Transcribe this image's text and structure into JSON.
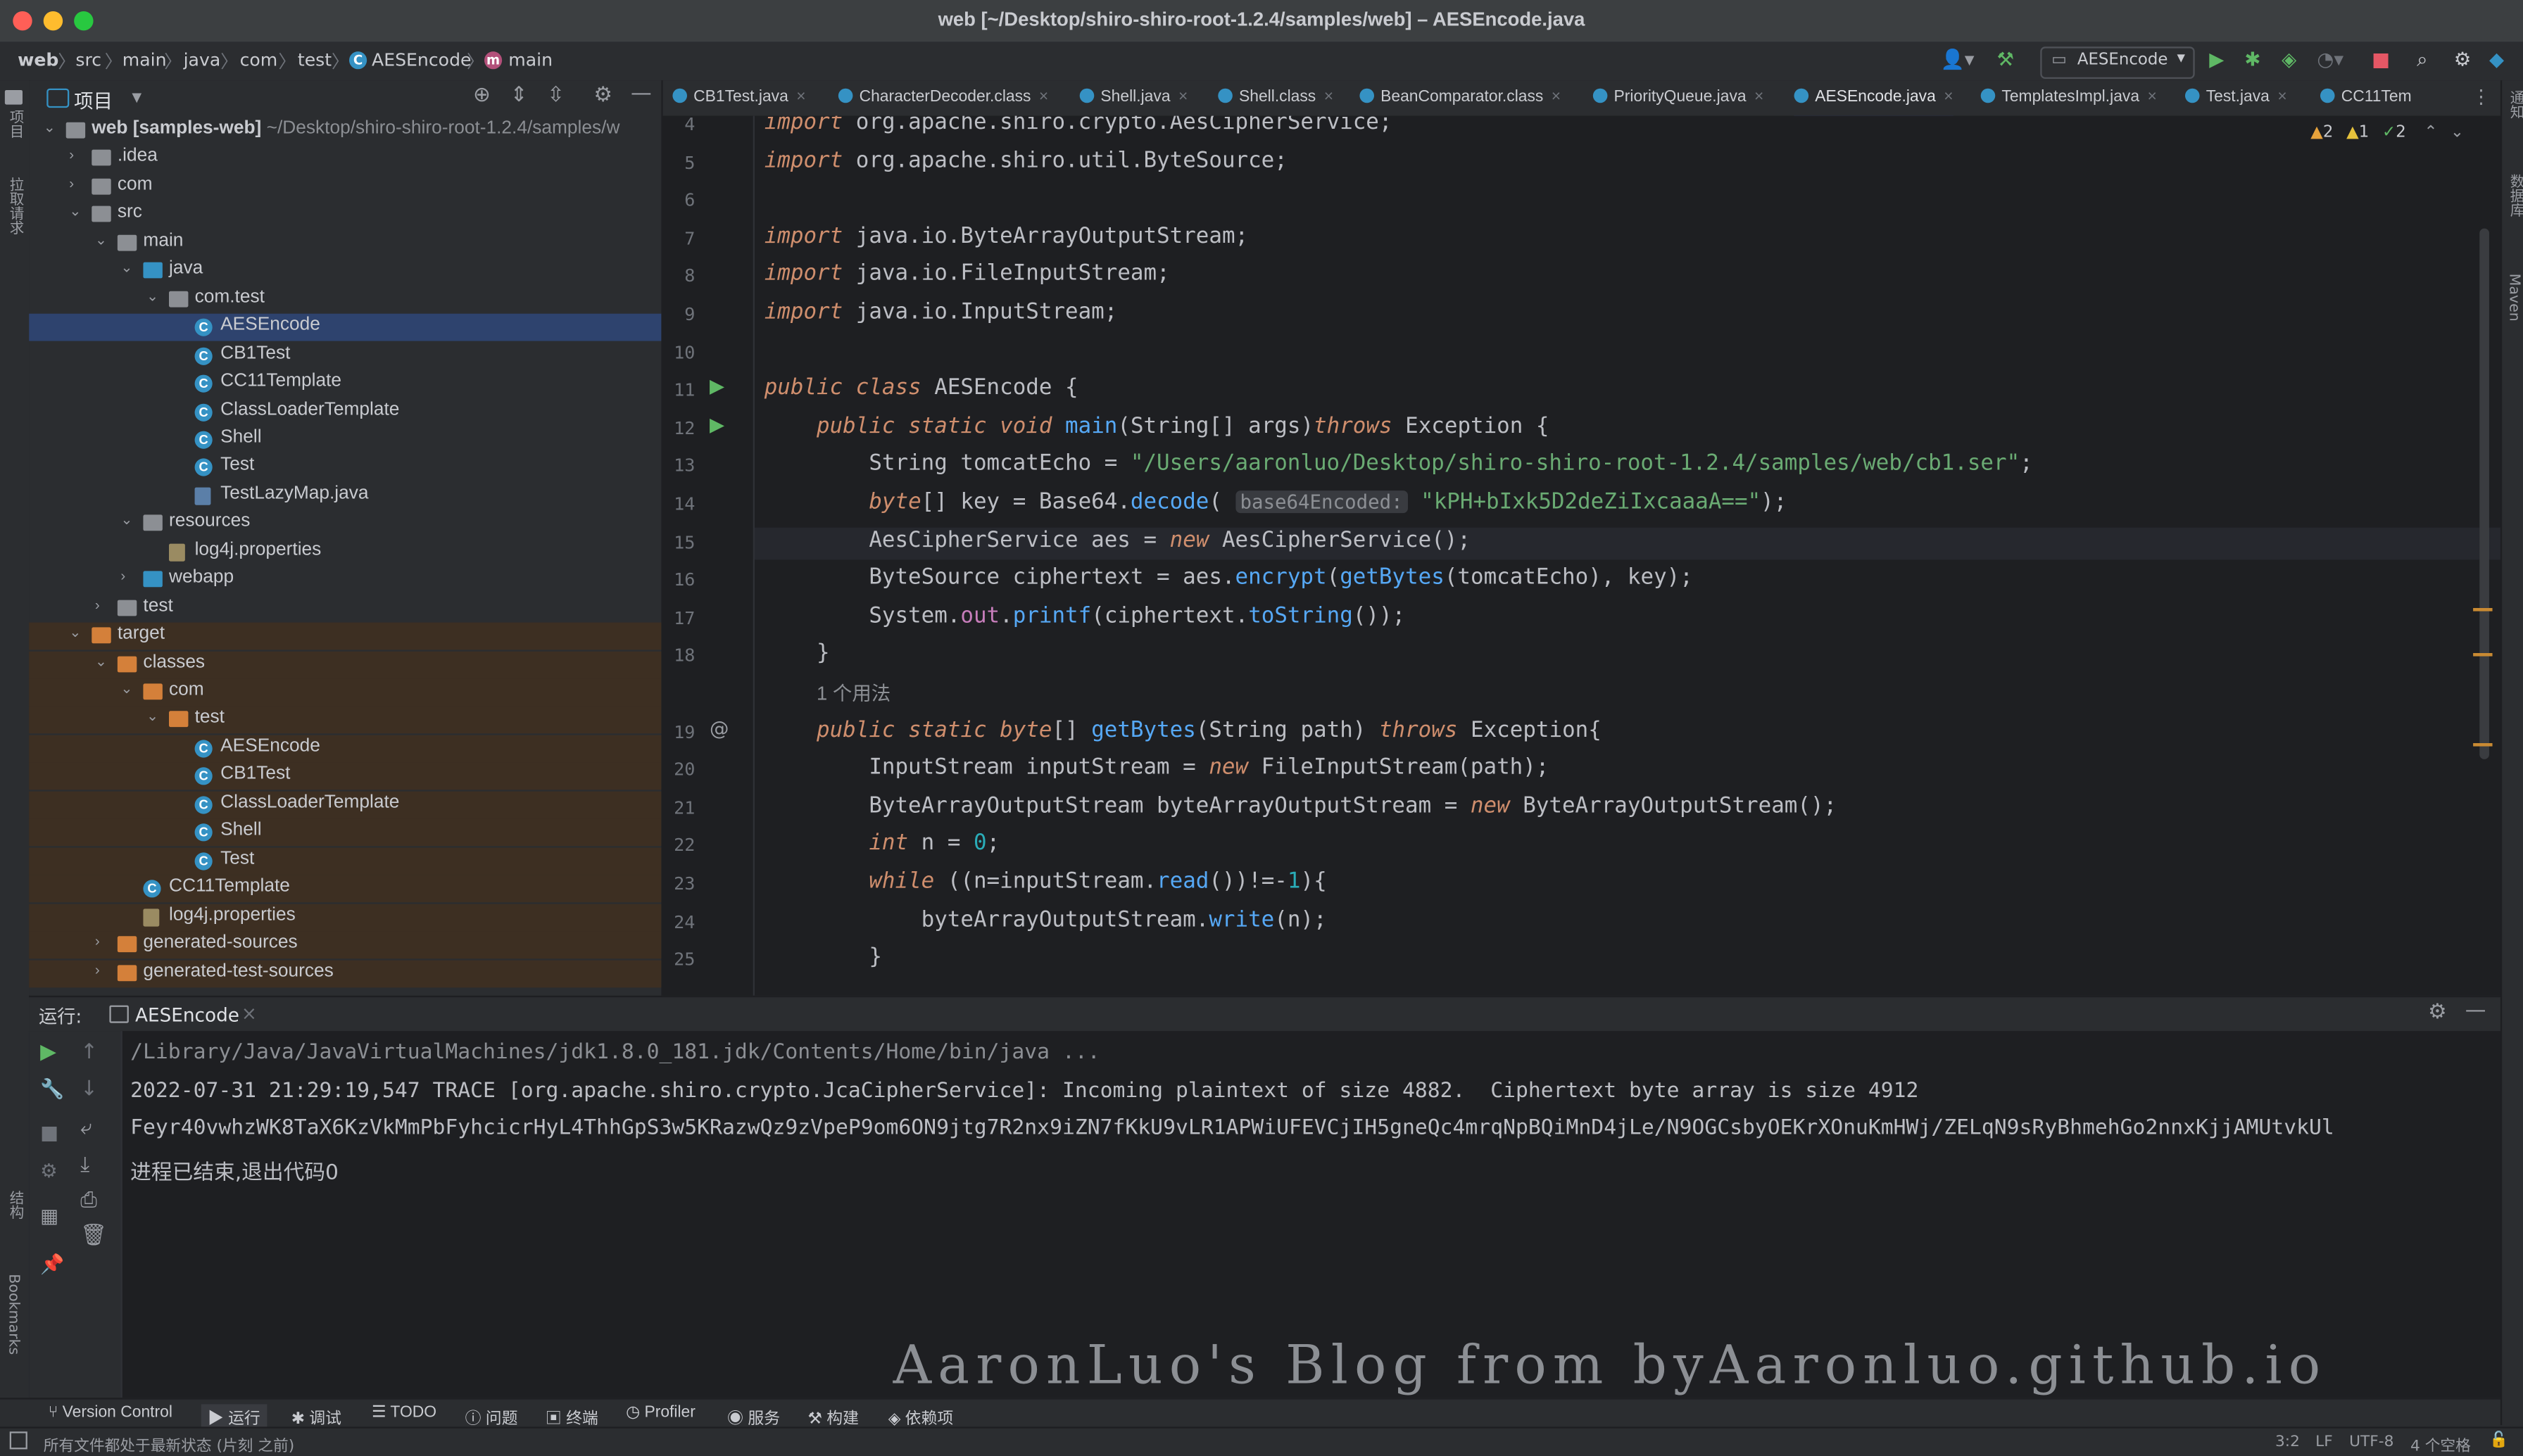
{
  "window": {
    "title": "web [~/Desktop/shiro-shiro-root-1.2.4/samples/web] – AESEncode.java"
  },
  "navbar": {
    "crumbs": [
      "web",
      "src",
      "main",
      "java",
      "com",
      "test",
      "AESEncode",
      "main"
    ],
    "run_config": "AESEncode"
  },
  "left_stripe": {
    "top": "项目",
    "mid": "拉取请求",
    "structure": "结构",
    "bookmarks": "Bookmarks"
  },
  "right_stripe": {
    "top": "通知",
    "db": "数据库",
    "maven": "Maven"
  },
  "project": {
    "header": "项目",
    "tree": [
      {
        "label": "web [samples-web]",
        "suffix": " ~/Desktop/shiro-shiro-root-1.2.4/samples/w",
        "type": "module",
        "depth": 0,
        "open": true
      },
      {
        "label": ".idea",
        "type": "folder",
        "depth": 1,
        "open": false
      },
      {
        "label": "com",
        "type": "folder",
        "depth": 1,
        "open": false
      },
      {
        "label": "src",
        "type": "folder",
        "depth": 1,
        "open": true
      },
      {
        "label": "main",
        "type": "folder",
        "depth": 2,
        "open": true
      },
      {
        "label": "java",
        "type": "srcfolder",
        "depth": 3,
        "open": true
      },
      {
        "label": "com.test",
        "type": "package",
        "depth": 4,
        "open": true
      },
      {
        "label": "AESEncode",
        "type": "class",
        "depth": 5,
        "selected": true
      },
      {
        "label": "CB1Test",
        "type": "class",
        "depth": 5
      },
      {
        "label": "CC11Template",
        "type": "class",
        "depth": 5
      },
      {
        "label": "ClassLoaderTemplate",
        "type": "class",
        "depth": 5
      },
      {
        "label": "Shell",
        "type": "class",
        "depth": 5
      },
      {
        "label": "Test",
        "type": "class",
        "depth": 5
      },
      {
        "label": "TestLazyMap.java",
        "type": "javafile",
        "depth": 5
      },
      {
        "label": "resources",
        "type": "resfolder",
        "depth": 3,
        "open": true
      },
      {
        "label": "log4j.properties",
        "type": "props",
        "depth": 4
      },
      {
        "label": "webapp",
        "type": "webfolder",
        "depth": 3,
        "open": false
      },
      {
        "label": "test",
        "type": "folder",
        "depth": 2,
        "open": false
      },
      {
        "label": "target",
        "type": "orange",
        "depth": 1,
        "open": true,
        "excluded": true
      },
      {
        "label": "classes",
        "type": "orange",
        "depth": 2,
        "open": true,
        "excluded": true
      },
      {
        "label": "com",
        "type": "orange",
        "depth": 3,
        "open": true,
        "excluded": true
      },
      {
        "label": "test",
        "type": "orange",
        "depth": 4,
        "open": true,
        "excluded": true
      },
      {
        "label": "AESEncode",
        "type": "class",
        "depth": 5,
        "excluded": true
      },
      {
        "label": "CB1Test",
        "type": "class",
        "depth": 5,
        "excluded": true
      },
      {
        "label": "ClassLoaderTemplate",
        "type": "class",
        "depth": 5,
        "excluded": true
      },
      {
        "label": "Shell",
        "type": "class",
        "depth": 5,
        "excluded": true
      },
      {
        "label": "Test",
        "type": "class",
        "depth": 5,
        "excluded": true
      },
      {
        "label": "CC11Template",
        "type": "class",
        "depth": 3,
        "excluded": true
      },
      {
        "label": "log4j.properties",
        "type": "props",
        "depth": 3,
        "excluded": true
      },
      {
        "label": "generated-sources",
        "type": "orange",
        "depth": 2,
        "open": false,
        "excluded": true
      },
      {
        "label": "generated-test-sources",
        "type": "orange",
        "depth": 2,
        "open": false,
        "excluded": true
      }
    ]
  },
  "tabs": [
    {
      "label": "CB1Test.java"
    },
    {
      "label": "CharacterDecoder.class"
    },
    {
      "label": "Shell.java"
    },
    {
      "label": "Shell.class"
    },
    {
      "label": "BeanComparator.class"
    },
    {
      "label": "PriorityQueue.java"
    },
    {
      "label": "AESEncode.java",
      "active": true
    },
    {
      "label": "TemplatesImpl.java"
    },
    {
      "label": "Test.java"
    },
    {
      "label": "CC11Tem"
    }
  ],
  "inspections": {
    "warnings_a": "2",
    "warnings_b": "1",
    "ok": "2"
  },
  "editor": {
    "usage_hint": "1 个用法",
    "inlay_hint": "base64Encoded:",
    "lines": [
      {
        "n": "4",
        "html": "<span class='kw'>import</span> org.apache.shiro.crypto.AesCipherService;"
      },
      {
        "n": "5",
        "html": "<span class='kw'>import</span> org.apache.shiro.util.ByteSource;"
      },
      {
        "n": "6",
        "html": ""
      },
      {
        "n": "7",
        "html": "<span class='kw'>import</span> java.io.ByteArrayOutputStream;"
      },
      {
        "n": "8",
        "html": "<span class='kw'>import</span> java.io.FileInputStream;"
      },
      {
        "n": "9",
        "html": "<span class='kw'>import</span> java.io.InputStream;"
      },
      {
        "n": "10",
        "html": ""
      },
      {
        "n": "11",
        "html": "<span class='kw'>public class</span> AESEncode {"
      },
      {
        "n": "12",
        "html": "    <span class='kw'>public static void</span> <span class='fn'>main</span>(String[] args)<span class='kw'>throws</span> Exception {"
      },
      {
        "n": "13",
        "html": "        String tomcatEcho = <span class='str'>\"/Users/aaronluo/Desktop/shiro-shiro-root-1.2.4/samples/web/cb1.ser\"</span>;"
      },
      {
        "n": "14",
        "html": "        <span class='kw'>byte</span>[] key = Base64.<span class='fn'>decode</span>( <span class='hint' data-name='inlay-hint'>base64Encoded:</span> <span class='str'>\"kPH+bIxk5D2deZiIxcaaaA==\"</span>);"
      },
      {
        "n": "15",
        "html": "        AesCipherService aes = <span class='kw'>new</span> AesCipherService();"
      },
      {
        "n": "16",
        "html": "        ByteSource ciphertext = aes.<span class='fn'>encrypt</span>(<span class='fn'>getBytes</span>(tomcatEcho), key);"
      },
      {
        "n": "17",
        "html": "        System.<span class='field'>out</span>.<span class='fn'>printf</span>(ciphertext.<span class='fn'>toString</span>());"
      },
      {
        "n": "18",
        "html": "    }"
      },
      {
        "n": "",
        "html": "    <span style='color:#8c8f94;font-family:Liberation Sans,sans-serif;font-size:12px'>1 个用法</span>"
      },
      {
        "n": "19",
        "html": "    <span class='kw'>public static byte</span>[] <span class='fn'>getBytes</span>(String path) <span class='kw'>throws</span> Exception{"
      },
      {
        "n": "20",
        "html": "        InputStream inputStream = <span class='kw'>new</span> FileInputStream(path);"
      },
      {
        "n": "21",
        "html": "        ByteArrayOutputStream byteArrayOutputStream = <span class='kw'>new</span> ByteArrayOutputStream();"
      },
      {
        "n": "22",
        "html": "        <span class='kw'>int</span> n = <span class='num'>0</span>;"
      },
      {
        "n": "23",
        "html": "        <span class='kw'>while</span> ((n=inputStream.<span class='fn'>read</span>())!=-<span class='num'>1</span>){"
      },
      {
        "n": "24",
        "html": "            byteArrayOutputStream.<span class='fn'>write</span>(n);"
      },
      {
        "n": "25",
        "html": "        }"
      }
    ]
  },
  "run": {
    "label": "运行:",
    "tab": "AESEncode",
    "output": [
      "/Library/Java/JavaVirtualMachines/jdk1.8.0_181.jdk/Contents/Home/bin/java ...",
      "2022-07-31 21:29:19,547 TRACE [org.apache.shiro.crypto.JcaCipherService]: Incoming plaintext of size 4882.  Ciphertext byte array is size 4912",
      "Feyr40vwhzWK8TaX6KzVkMmPbFyhcicrHyL4ThhGpS3w5KRazwQz9zVpeP9om6ON9jtg7R2nx9iZN7fKkU9vLR1APWiUFEVCjIH5gneQc4mrqNpBQiMnD4jLe/N9OGCsbyOEKrXOnuKmHWj/ZELqN9sRyBhmehGo2nnxKjjAMUtvkUl",
      "进程已结束,退出代码0"
    ]
  },
  "watermark": "AaronLuo's Blog from byAaronluo.github.io",
  "toolwindows": [
    "Version Control",
    "运行",
    "调试",
    "TODO",
    "问题",
    "终端",
    "Profiler",
    "服务",
    "构建",
    "依赖项"
  ],
  "status": {
    "message": "所有文件都处于最新状态 (片刻 之前)",
    "position": "3:2",
    "line_sep": "LF",
    "encoding": "UTF-8",
    "indent": "4 个空格"
  },
  "colors": {
    "accent": "#3574f0",
    "run_green": "#5fb865",
    "stop_red": "#e55765",
    "excluded_bg": "#3d2f22"
  }
}
